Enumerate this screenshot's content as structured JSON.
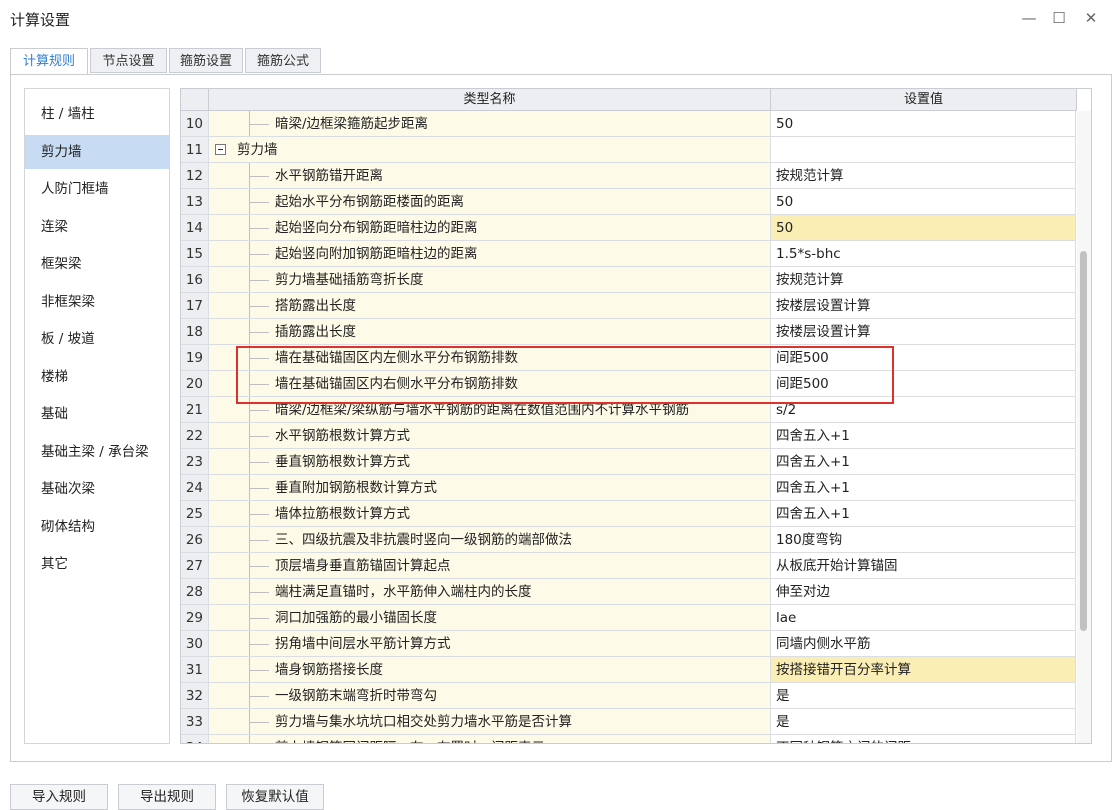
{
  "window": {
    "title": "计算设置",
    "minimize": "—",
    "maximize": "☐",
    "close": "✕"
  },
  "tabs": [
    "计算规则",
    "节点设置",
    "箍筋设置",
    "箍筋公式"
  ],
  "sidebar": [
    "柱 / 墙柱",
    "剪力墙",
    "人防门框墙",
    "连梁",
    "框架梁",
    "非框架梁",
    "板 / 坡道",
    "楼梯",
    "基础",
    "基础主梁 / 承台梁",
    "基础次梁",
    "砌体结构",
    "其它"
  ],
  "table": {
    "headers": [
      "类型名称",
      "设置值"
    ],
    "rows": [
      {
        "no": "10",
        "name": "暗梁/边框梁箍筋起步距离",
        "value": "50"
      },
      {
        "no": "11",
        "name": "剪力墙",
        "value": "",
        "group": true
      },
      {
        "no": "12",
        "name": "水平钢筋错开距离",
        "value": "按规范计算"
      },
      {
        "no": "13",
        "name": "起始水平分布钢筋距楼面的距离",
        "value": "50"
      },
      {
        "no": "14",
        "name": "起始竖向分布钢筋距暗柱边的距离",
        "value": "50",
        "hl": true
      },
      {
        "no": "15",
        "name": "起始竖向附加钢筋距暗柱边的距离",
        "value": "1.5*s-bhc"
      },
      {
        "no": "16",
        "name": "剪力墙基础插筋弯折长度",
        "value": "按规范计算"
      },
      {
        "no": "17",
        "name": "搭筋露出长度",
        "value": "按楼层设置计算"
      },
      {
        "no": "18",
        "name": "插筋露出长度",
        "value": "按楼层设置计算"
      },
      {
        "no": "19",
        "name": "墙在基础锚固区内左侧水平分布钢筋排数",
        "value": "间距500"
      },
      {
        "no": "20",
        "name": "墙在基础锚固区内右侧水平分布钢筋排数",
        "value": "间距500"
      },
      {
        "no": "21",
        "name": "暗梁/边框梁/梁纵筋与墙水平钢筋的距离在数值范围内不计算水平钢筋",
        "value": "s/2"
      },
      {
        "no": "22",
        "name": "水平钢筋根数计算方式",
        "value": "四舍五入+1"
      },
      {
        "no": "23",
        "name": "垂直钢筋根数计算方式",
        "value": "四舍五入+1"
      },
      {
        "no": "24",
        "name": "垂直附加钢筋根数计算方式",
        "value": "四舍五入+1"
      },
      {
        "no": "25",
        "name": "墙体拉筋根数计算方式",
        "value": "四舍五入+1"
      },
      {
        "no": "26",
        "name": "三、四级抗震及非抗震时竖向一级钢筋的端部做法",
        "value": "180度弯钩"
      },
      {
        "no": "27",
        "name": "顶层墙身垂直筋锚固计算起点",
        "value": "从板底开始计算锚固"
      },
      {
        "no": "28",
        "name": "端柱满足直锚时，水平筋伸入端柱内的长度",
        "value": "伸至对边"
      },
      {
        "no": "29",
        "name": "洞口加强筋的最小锚固长度",
        "value": "lae"
      },
      {
        "no": "30",
        "name": "拐角墙中间层水平筋计算方式",
        "value": "同墙内侧水平筋"
      },
      {
        "no": "31",
        "name": "墙身钢筋搭接长度",
        "value": "按搭接错开百分率计算",
        "hl": true
      },
      {
        "no": "32",
        "name": "一级钢筋末端弯折时带弯勾",
        "value": "是"
      },
      {
        "no": "33",
        "name": "剪力墙与集水坑坑口相交处剪力墙水平筋是否计算",
        "value": "是"
      },
      {
        "no": "34",
        "name": "剪力墙钢筋同间距隔一布一布置时，间距表示",
        "value": "不同种钢筋之间的间距"
      }
    ]
  },
  "buttons": [
    "导入规则",
    "导出规则",
    "恢复默认值"
  ]
}
